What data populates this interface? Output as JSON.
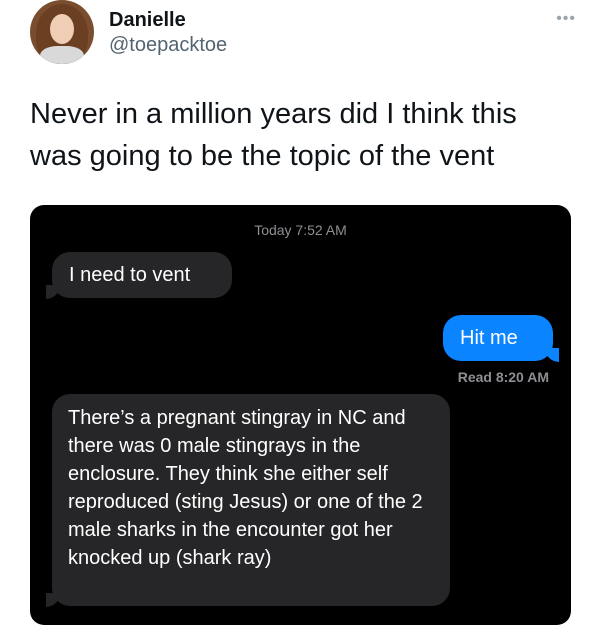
{
  "tweet": {
    "author_name": "Danielle",
    "author_handle": "@toepacktoe",
    "more_icon": "more-options-icon",
    "text": "Never in a million years did I think this was going to be the topic of the vent"
  },
  "chat": {
    "timestamp": "Today 7:52 AM",
    "messages": [
      {
        "direction": "incoming",
        "text": "I need to vent"
      },
      {
        "direction": "outgoing",
        "text": "Hit me"
      },
      {
        "direction": "incoming",
        "text": "There’s a pregnant stingray in NC and there was 0 male stingrays in the enclosure. They think she either self reproduced (sting Jesus) or one of the 2 male sharks in the encounter got her knocked up (shark ray)"
      }
    ],
    "read_receipt": "Read 8:20 AM",
    "colors": {
      "incoming_bubble": "#262628",
      "outgoing_bubble": "#0a84ff",
      "background": "#000000"
    }
  }
}
